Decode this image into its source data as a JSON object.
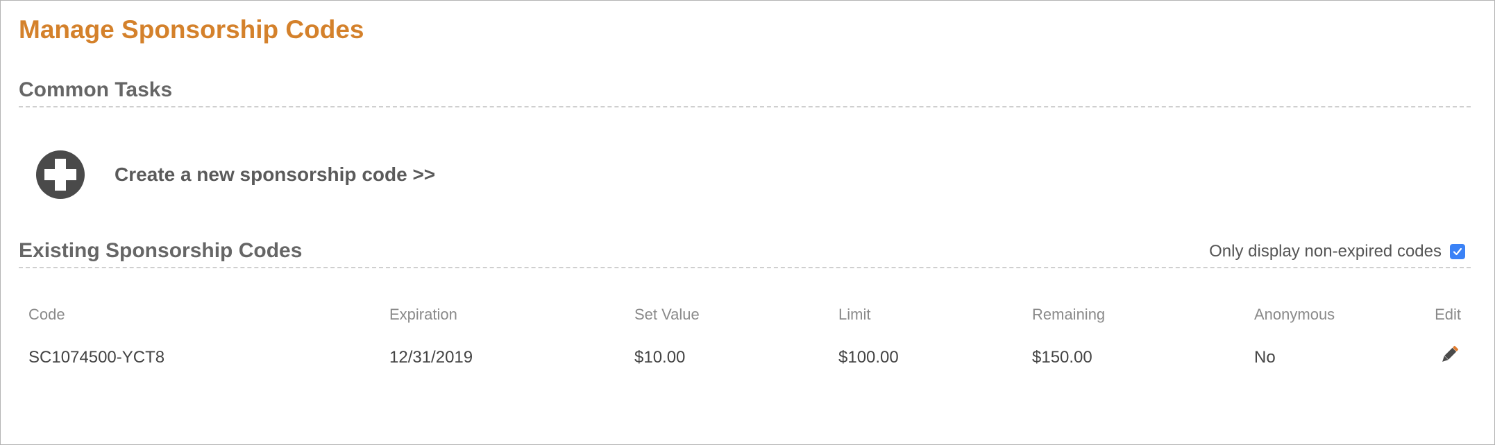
{
  "page": {
    "title": "Manage Sponsorship Codes"
  },
  "common_tasks": {
    "heading": "Common Tasks",
    "create_label": "Create a new sponsorship code  >>",
    "create_icon": "plus-circle-icon"
  },
  "existing": {
    "heading": "Existing Sponsorship Codes",
    "filter_label": "Only display non-expired codes",
    "filter_checked": true,
    "columns": [
      "Code",
      "Expiration",
      "Set Value",
      "Limit",
      "Remaining",
      "Anonymous",
      "Edit"
    ],
    "rows": [
      {
        "code": "SC1074500-YCT8",
        "expiration": "12/31/2019",
        "set_value": "$10.00",
        "limit": "$100.00",
        "remaining": "$150.00",
        "anonymous": "No",
        "edit_icon": "pencil-icon"
      }
    ]
  },
  "colors": {
    "title": "#d4812b",
    "heading": "#666666",
    "checkbox": "#3b82f6",
    "icon": "#4a4a4a"
  }
}
